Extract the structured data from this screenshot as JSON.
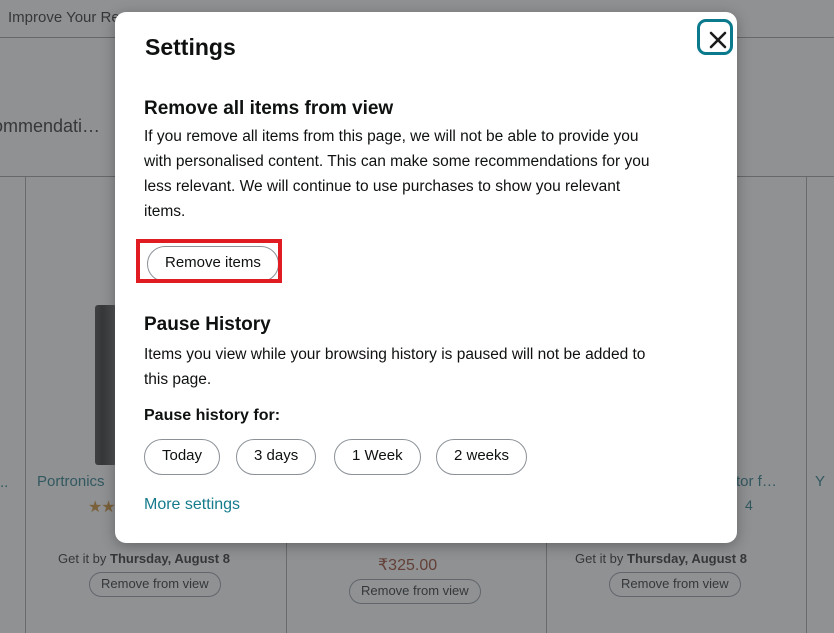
{
  "background": {
    "header_title": "Improve Your Re…",
    "sub_text": "recommendati…",
    "cards": [
      {
        "title": "Portronics",
        "stars": "★★",
        "rating": "",
        "price": "",
        "delivery_prefix": "Get it by ",
        "delivery_date": "Thursday, August 8",
        "remove_label": "Remove from view"
      },
      {
        "title": "",
        "stars": "",
        "rating": "",
        "price": "₹325.00",
        "delivery_prefix": "",
        "delivery_date": "",
        "remove_label": "Remove from view"
      },
      {
        "title": "tor f…",
        "stars": "",
        "rating": "4",
        "price": "",
        "delivery_prefix": "Get it by ",
        "delivery_date": "Thursday, August 8",
        "remove_label": "Remove from view"
      },
      {
        "title": "Y",
        "stars": "",
        "rating": "",
        "price": "",
        "delivery_prefix": "",
        "delivery_date": "",
        "remove_label": ""
      }
    ],
    "left_truncated_title": ".."
  },
  "modal": {
    "title": "Settings",
    "close_icon": "close-icon",
    "remove_section": {
      "heading": "Remove all items from view",
      "body": "If you remove all items from this page, we will not be able to provide you with personalised content. This can make some recommendations for you less relevant. We will continue to use purchases to show you relevant items.",
      "button_label": "Remove items"
    },
    "pause_section": {
      "heading": "Pause History",
      "body": "Items you view while your browsing history is paused will not be added to this page.",
      "subheading": "Pause history for:",
      "options": [
        "Today",
        "3 days",
        "1 Week",
        "2 weeks"
      ]
    },
    "more_settings_label": "More settings"
  },
  "annotations": {
    "red_target": "remove-items-button",
    "red_color": "#e01c22",
    "teal_target": "close-button",
    "teal_color": "#0b7a8c"
  },
  "colors": {
    "link_teal": "#157b8c",
    "price_red": "#8c2b0e",
    "star_gold": "#c7801a",
    "overlay": "rgba(75,78,80,0.62)"
  }
}
